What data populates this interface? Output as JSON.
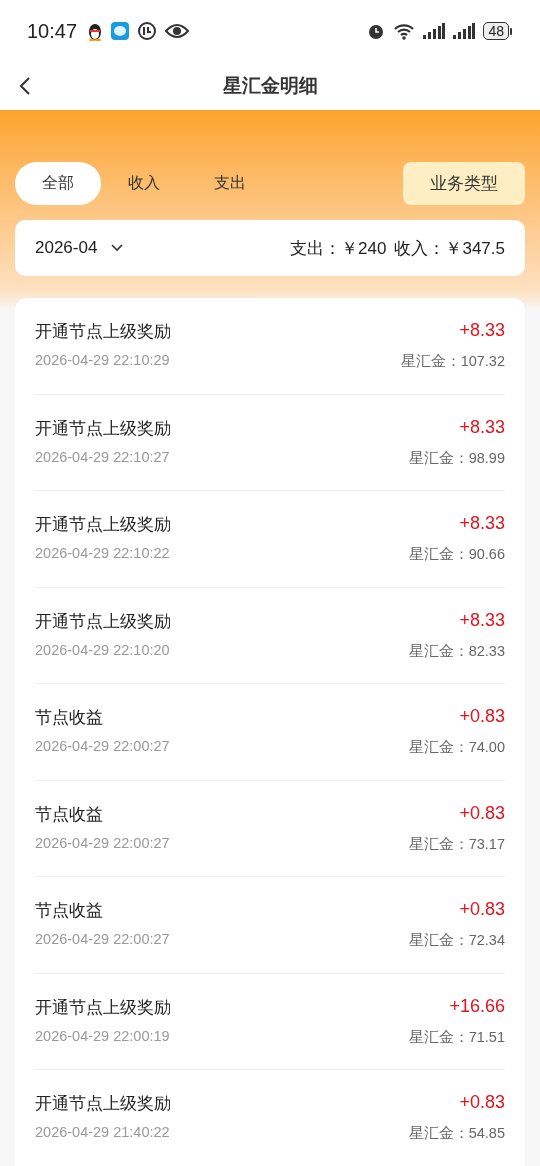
{
  "status_bar": {
    "time": "10:47",
    "battery": "48"
  },
  "header": {
    "title": "星汇金明细"
  },
  "tabs": [
    {
      "label": "全部",
      "selected": true
    },
    {
      "label": "收入",
      "selected": false
    },
    {
      "label": "支出",
      "selected": false
    }
  ],
  "type_button": "业务类型",
  "summary": {
    "month": "2026-04",
    "expense": "支出：￥240",
    "income": "收入：￥347.5"
  },
  "records": [
    {
      "title": "开通节点上级奖励",
      "time": "2026-04-29 22:10:29",
      "amount": "+8.33",
      "balance": "星汇金：107.32"
    },
    {
      "title": "开通节点上级奖励",
      "time": "2026-04-29 22:10:27",
      "amount": "+8.33",
      "balance": "星汇金：98.99"
    },
    {
      "title": "开通节点上级奖励",
      "time": "2026-04-29 22:10:22",
      "amount": "+8.33",
      "balance": "星汇金：90.66"
    },
    {
      "title": "开通节点上级奖励",
      "time": "2026-04-29 22:10:20",
      "amount": "+8.33",
      "balance": "星汇金：82.33"
    },
    {
      "title": "节点收益",
      "time": "2026-04-29 22:00:27",
      "amount": "+0.83",
      "balance": "星汇金：74.00"
    },
    {
      "title": "节点收益",
      "time": "2026-04-29 22:00:27",
      "amount": "+0.83",
      "balance": "星汇金：73.17"
    },
    {
      "title": "节点收益",
      "time": "2026-04-29 22:00:27",
      "amount": "+0.83",
      "balance": "星汇金：72.34"
    },
    {
      "title": "开通节点上级奖励",
      "time": "2026-04-29 22:00:19",
      "amount": "+16.66",
      "balance": "星汇金：71.51"
    },
    {
      "title": "开通节点上级奖励",
      "time": "2026-04-29 21:40:22",
      "amount": "+0.83",
      "balance": "星汇金：54.85"
    }
  ]
}
